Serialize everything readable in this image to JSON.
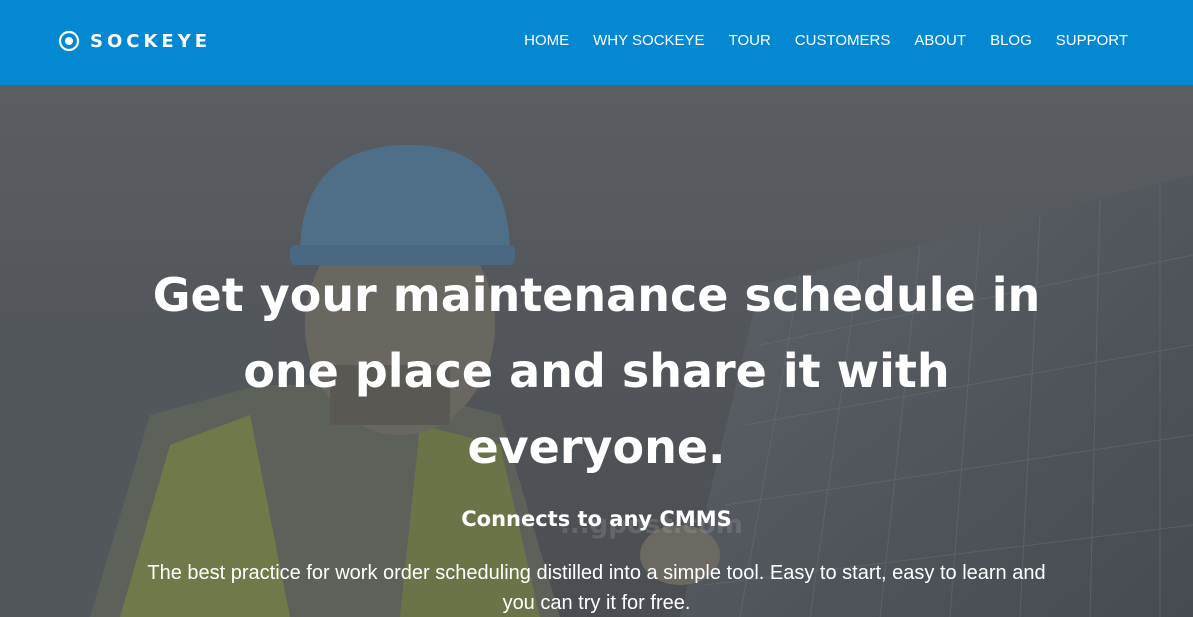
{
  "brand": {
    "name": "SOCKEYE",
    "color": "#0388d1"
  },
  "nav": {
    "items": [
      {
        "label": "HOME"
      },
      {
        "label": "WHY SOCKEYE"
      },
      {
        "label": "TOUR"
      },
      {
        "label": "CUSTOMERS"
      },
      {
        "label": "ABOUT"
      },
      {
        "label": "BLOG"
      },
      {
        "label": "SUPPORT"
      }
    ]
  },
  "hero": {
    "headline": "Get your maintenance schedule in one place and share it with everyone.",
    "subheadline": "Connects to any CMMS",
    "description": "The best practice for work order scheduling distilled into a simple tool. Easy to start, easy to learn and you can try it for free.",
    "background_image": "worker-in-hard-hat-near-solar-panels"
  },
  "watermark": {
    "text": "...gpost.com"
  }
}
